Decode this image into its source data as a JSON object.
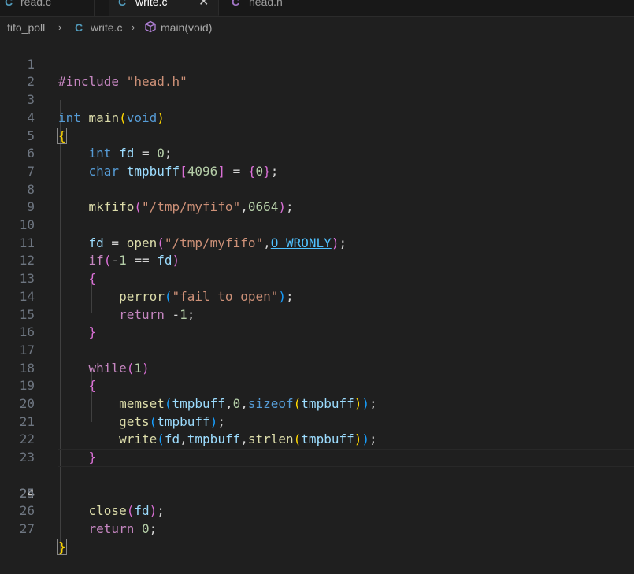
{
  "tabs": [
    {
      "icon": "C",
      "label": "read.c",
      "active": false
    },
    {
      "icon": "C",
      "label": "write.c",
      "active": true,
      "close": "✕"
    },
    {
      "icon": "C",
      "label": "head.h",
      "active": false
    }
  ],
  "breadcrumb": {
    "folder": "fifo_poll",
    "sep": "›",
    "file_icon": "C",
    "file": "write.c",
    "symbol_icon": "cube-icon",
    "symbol": "main(void)"
  },
  "editor": {
    "current_line": 24,
    "line_numbers": [
      "1",
      "2",
      "3",
      "4",
      "5",
      "6",
      "7",
      "8",
      "9",
      "10",
      "11",
      "12",
      "13",
      "14",
      "15",
      "16",
      "17",
      "18",
      "19",
      "20",
      "21",
      "22",
      "23",
      "24",
      "25",
      "26",
      "27"
    ]
  },
  "code": {
    "l1": {
      "include": "#include",
      "path": "\"head.h\""
    },
    "l3": {
      "type": "int",
      "name": "main",
      "lp": "(",
      "param": "void",
      "rp": ")"
    },
    "l4": {
      "brace": "{"
    },
    "l5": {
      "type": "int",
      "var": "fd",
      "eq": " = ",
      "num": "0",
      "end": ";"
    },
    "l6": {
      "type": "char",
      "var": "tmpbuff",
      "lb": "[",
      "num": "4096",
      "rb": "]",
      "eq": " = ",
      "lc": "{",
      "num2": "0",
      "rc": "}",
      "end": ";"
    },
    "l8": {
      "fn": "mkfifo",
      "lp": "(",
      "str": "\"/tmp/myfifo\"",
      "comma": ",",
      "num": "0664",
      "rp": ")",
      "end": ";"
    },
    "l10": {
      "var": "fd",
      "eq": " = ",
      "fn": "open",
      "lp": "(",
      "str": "\"/tmp/myfifo\"",
      "comma": ",",
      "const": "O_WRONLY",
      "rp": ")",
      "end": ";"
    },
    "l11": {
      "kw": "if",
      "lp": "(",
      "op": "-",
      "num": "1",
      "eq": " == ",
      "var": "fd",
      "rp": ")"
    },
    "l12": {
      "brace": "{"
    },
    "l13": {
      "fn": "perror",
      "lp": "(",
      "str": "\"fail to open\"",
      "rp": ")",
      "end": ";"
    },
    "l14": {
      "kw": "return",
      "op": " -",
      "num": "1",
      "end": ";"
    },
    "l15": {
      "brace": "}"
    },
    "l17": {
      "kw": "while",
      "lp": "(",
      "num": "1",
      "rp": ")"
    },
    "l18": {
      "brace": "{"
    },
    "l19": {
      "fn": "memset",
      "lp": "(",
      "var": "tmpbuff",
      "c1": ",",
      "num": "0",
      "c2": ",",
      "kw": "sizeof",
      "lp2": "(",
      "var2": "tmpbuff",
      "rp2": ")",
      "rp": ")",
      "end": ";"
    },
    "l20": {
      "fn": "gets",
      "lp": "(",
      "var": "tmpbuff",
      "rp": ")",
      "end": ";"
    },
    "l21": {
      "fn": "write",
      "lp": "(",
      "var": "fd",
      "c1": ",",
      "var2": "tmpbuff",
      "c2": ",",
      "fn2": "strlen",
      "lp2": "(",
      "var3": "tmpbuff",
      "rp2": ")",
      "rp": ")",
      "end": ";"
    },
    "l22": {
      "brace": "}"
    },
    "l24": {
      "fn": "close",
      "lp": "(",
      "var": "fd",
      "rp": ")",
      "end": ";"
    },
    "l26": {
      "kw": "return",
      "sp": " ",
      "num": "0",
      "end": ";"
    },
    "l27": {
      "brace": "}"
    }
  },
  "colors": {
    "background": "#1f1f1f",
    "keyword": "#569cd6",
    "control": "#c586c0",
    "string": "#ce9178",
    "number": "#b5cea8",
    "function": "#dcdcaa",
    "variable": "#9cdcfe",
    "c_file_icon": "#519aba",
    "h_file_icon": "#a074c4"
  }
}
